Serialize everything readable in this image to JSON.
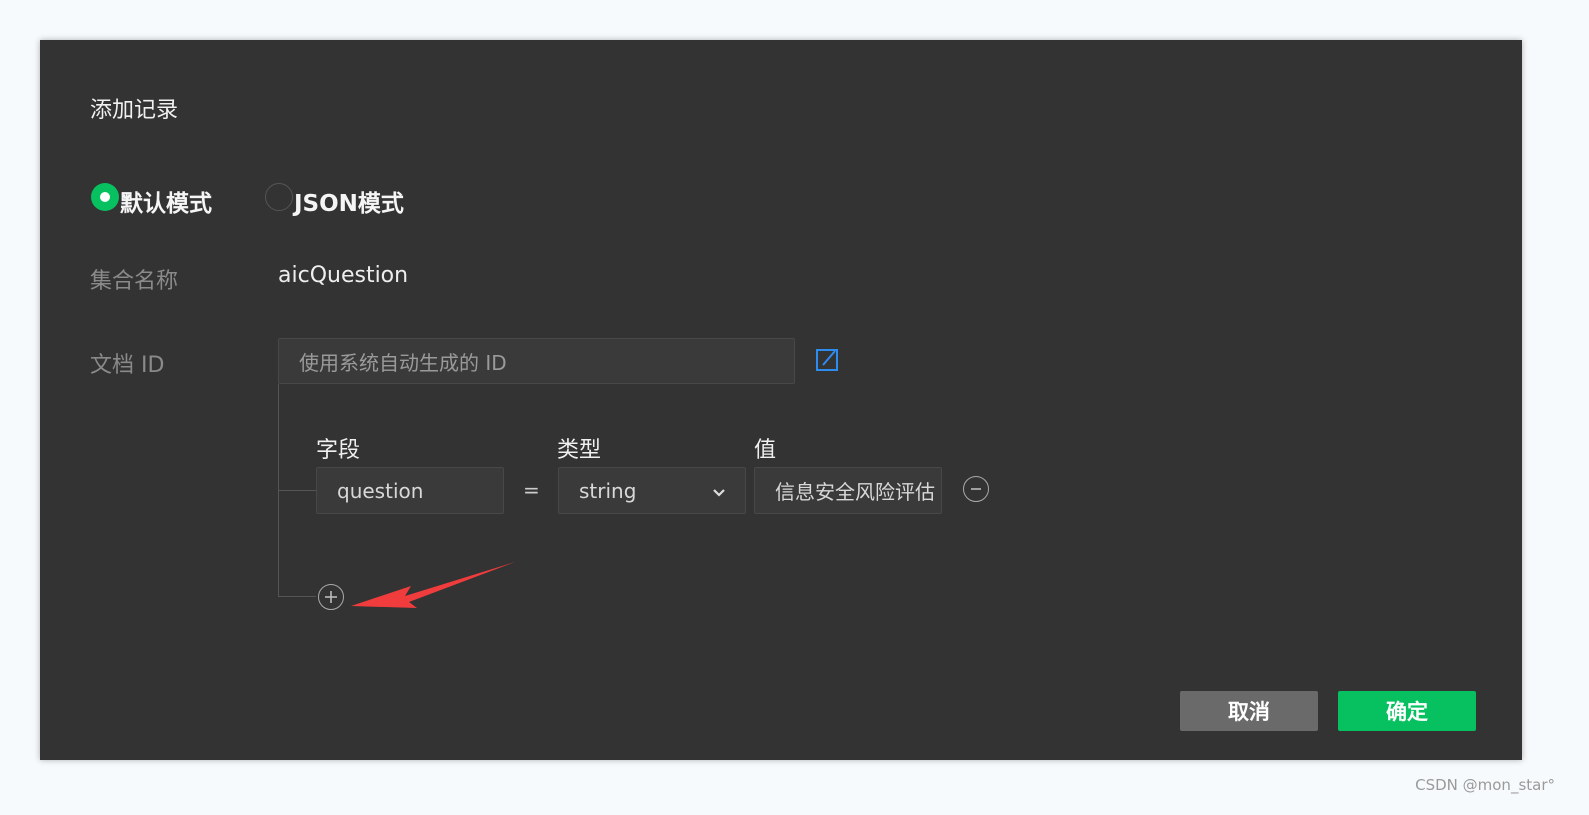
{
  "dialog": {
    "title": "添加记录",
    "modes": [
      {
        "label": "默认模式",
        "selected": true
      },
      {
        "label": "JSON模式",
        "selected": false
      }
    ],
    "collection_label": "集合名称",
    "collection_value": "aicQuestion",
    "doc_id_label": "文档 ID",
    "doc_id_placeholder": "使用系统自动生成的 ID",
    "columns": {
      "field": "字段",
      "type": "类型",
      "value": "值"
    },
    "rows": [
      {
        "field": "question",
        "equals": "=",
        "type": "string",
        "value": "信息安全风险评估"
      }
    ],
    "cancel_label": "取消",
    "confirm_label": "确定"
  },
  "colors": {
    "accent": "#07c160",
    "edit_icon": "#2d8cf0",
    "arrow": "#f03c3c"
  },
  "watermark": "CSDN @mon_star°"
}
